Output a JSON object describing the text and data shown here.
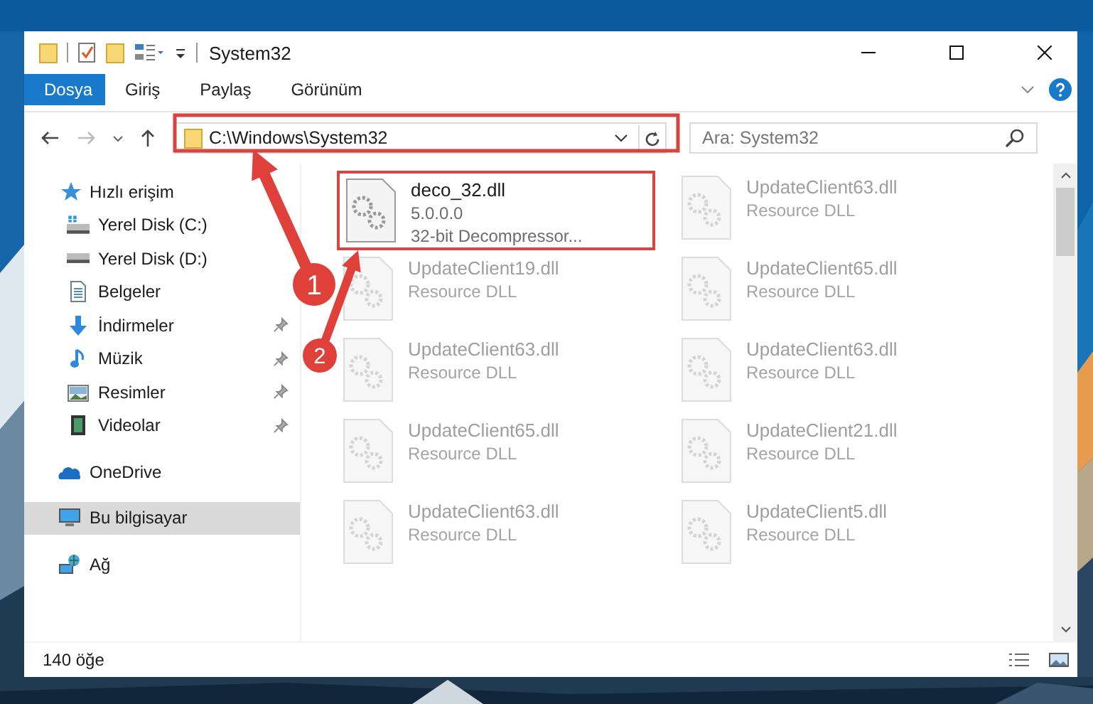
{
  "window": {
    "title": "System32"
  },
  "ribbon_tabs": [
    {
      "label": "Dosya",
      "selected": true
    },
    {
      "label": "Giriş",
      "selected": false
    },
    {
      "label": "Paylaş",
      "selected": false
    },
    {
      "label": "Görünüm",
      "selected": false
    }
  ],
  "address": {
    "path": "C:\\Windows\\System32"
  },
  "search": {
    "placeholder": "Ara: System32"
  },
  "nav": [
    {
      "label": "Hızlı erişim",
      "selected": false,
      "children": [
        {
          "label": "Yerel Disk (C:)",
          "selected": false,
          "pinned": false
        },
        {
          "label": "Yerel Disk (D:)",
          "selected": false,
          "pinned": false
        },
        {
          "label": "Belgeler",
          "selected": false,
          "pinned": false
        },
        {
          "label": "İndirmeler",
          "selected": false,
          "pinned": true
        },
        {
          "label": "Müzik",
          "selected": false,
          "pinned": true
        },
        {
          "label": "Resimler",
          "selected": false,
          "pinned": true
        },
        {
          "label": "Videolar",
          "selected": false,
          "pinned": true
        }
      ]
    },
    {
      "label": "OneDrive",
      "selected": false
    },
    {
      "label": "Bu bilgisayar",
      "selected": true
    },
    {
      "label": "Ağ",
      "selected": false
    }
  ],
  "files": [
    {
      "name": "deco_32.dll",
      "lines": [
        "5.0.0.0",
        "32-bit Decompressor..."
      ],
      "kind": "highlighted"
    },
    {
      "name": "UpdateClient63.dll",
      "lines": [
        "Resource DLL"
      ],
      "kind": "faded"
    },
    {
      "name": "UpdateClient19.dll",
      "lines": [
        "Resource DLL"
      ],
      "kind": "faded"
    },
    {
      "name": "UpdateClient65.dll",
      "lines": [
        "Resource DLL"
      ],
      "kind": "faded"
    },
    {
      "name": "UpdateClient63.dll",
      "lines": [
        "Resource DLL"
      ],
      "kind": "faded"
    },
    {
      "name": "UpdateClient63.dll",
      "lines": [
        "Resource DLL"
      ],
      "kind": "faded"
    },
    {
      "name": "UpdateClient65.dll",
      "lines": [
        "Resource DLL"
      ],
      "kind": "faded"
    },
    {
      "name": "UpdateClient21.dll",
      "lines": [
        "Resource DLL"
      ],
      "kind": "faded"
    },
    {
      "name": "UpdateClient63.dll",
      "lines": [
        "Resource DLL"
      ],
      "kind": "faded"
    },
    {
      "name": "UpdateClient5.dll",
      "lines": [
        "Resource DLL"
      ],
      "kind": "faded"
    }
  ],
  "status_bar": {
    "count": "140 öğe"
  },
  "callouts": [
    {
      "number": "1"
    },
    {
      "number": "2"
    }
  ]
}
